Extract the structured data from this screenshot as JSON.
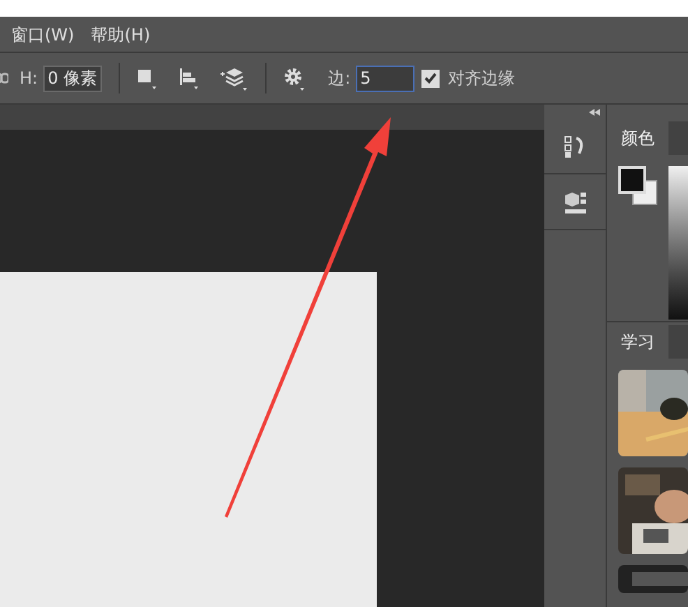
{
  "menu": [
    {
      "label": "窗口(W)"
    },
    {
      "label": "帮助(H)"
    }
  ],
  "options_bar": {
    "height_label": "H:",
    "height_value": "0 像素",
    "edge_label": "边:",
    "edge_value": "5",
    "snap_to_edge": {
      "label": "对齐边缘",
      "checked": true
    }
  },
  "right_panel": {
    "color_tabs": [
      {
        "label": "颜色",
        "selected": true
      }
    ],
    "learn_tabs": [
      {
        "label": "学习",
        "selected": true
      }
    ]
  }
}
